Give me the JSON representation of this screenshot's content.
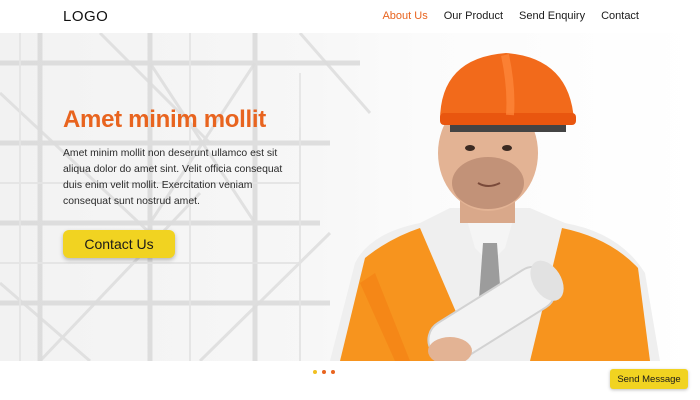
{
  "header": {
    "logo": "LOGO",
    "nav": [
      "About Us",
      "Our Product",
      "Send Enquiry",
      "Contact"
    ],
    "active_nav": "About Us"
  },
  "hero": {
    "title": "Amet minim mollit",
    "text": "Amet minim mollit non deserunt ullamco est sit aliqua dolor do amet sint. Velit officia consequat duis enim velit mollit. Exercitation veniam consequat sunt nostrud amet.",
    "button_label": "Contact Us"
  },
  "carousel": {
    "dot_count": 3,
    "active_index": 0
  },
  "send_message_label": "Send Message",
  "colors": {
    "accent_orange": "#e8641f",
    "accent_yellow": "#f1d321",
    "hardhat": "#f26a1b",
    "vest": "#f7941e"
  },
  "icons": [
    "carousel-dot"
  ]
}
